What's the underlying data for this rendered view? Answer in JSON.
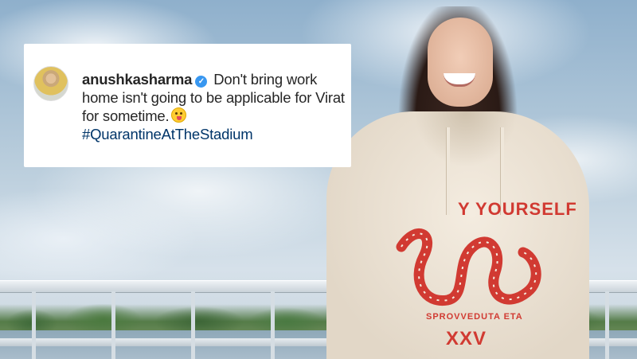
{
  "post": {
    "username": "anushkasharma",
    "verified_mark": "✓",
    "caption_text": "Don't bring work home isn't going to be applicable for Virat for sometime.",
    "emoji_name": "face-savoring-food",
    "hashtag": "#QuarantineAtTheStadium"
  },
  "photo": {
    "hoodie_print_line1": "Y YOURSELF",
    "hoodie_print_line2": "SPROVVEDUTA ETA",
    "hoodie_print_line3": "XXV"
  },
  "colors": {
    "hoodie_print": "#d13a32",
    "hashtag": "#003569",
    "verified_badge": "#3897f0"
  }
}
